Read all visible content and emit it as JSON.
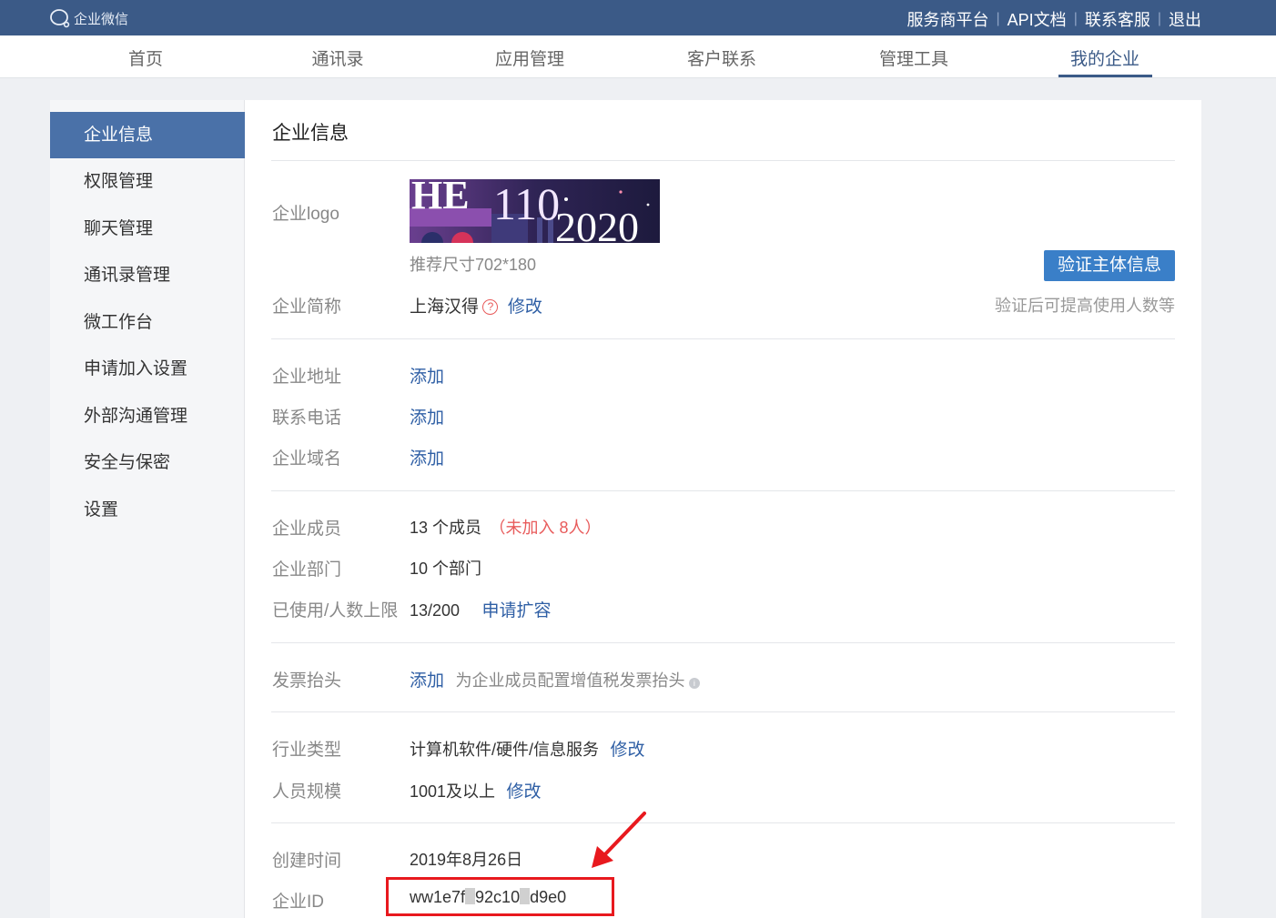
{
  "topbar": {
    "brand": "企业微信",
    "links": [
      "服务商平台",
      "API文档",
      "联系客服",
      "退出"
    ]
  },
  "nav": {
    "items": [
      "首页",
      "通讯录",
      "应用管理",
      "客户联系",
      "管理工具",
      "我的企业"
    ],
    "active": "我的企业"
  },
  "sidebar": {
    "items": [
      "企业信息",
      "权限管理",
      "聊天管理",
      "通讯录管理",
      "微工作台",
      "申请加入设置",
      "外部沟通管理",
      "安全与保密",
      "设置"
    ],
    "active": "企业信息"
  },
  "main": {
    "title": "企业信息",
    "logo": {
      "label": "企业logo",
      "image_text_1": "HE",
      "image_text_2": "110",
      "image_text_3": "2020",
      "hint": "推荐尺寸702*180"
    },
    "verify": {
      "button_label": "验证主体信息",
      "note": "验证后可提高使用人数等"
    },
    "short_name": {
      "label": "企业简称",
      "value": "上海汉得",
      "help_icon": "?",
      "edit": "修改"
    },
    "address": {
      "label": "企业地址",
      "action": "添加"
    },
    "phone": {
      "label": "联系电话",
      "action": "添加"
    },
    "domain": {
      "label": "企业域名",
      "action": "添加"
    },
    "members": {
      "label": "企业成员",
      "value": "13 个成员",
      "not_joined": "（未加入 8人）"
    },
    "departments": {
      "label": "企业部门",
      "value": "10 个部门"
    },
    "usage": {
      "label": "已使用/人数上限",
      "value": "13/200",
      "action": "申请扩容"
    },
    "invoice": {
      "label": "发票抬头",
      "action": "添加",
      "desc": "为企业成员配置增值税发票抬头",
      "info_icon": "i"
    },
    "industry": {
      "label": "行业类型",
      "value": "计算机软件/硬件/信息服务",
      "edit": "修改"
    },
    "scale": {
      "label": "人员规模",
      "value": "1001及以上",
      "edit": "修改"
    },
    "created": {
      "label": "创建时间",
      "value": "2019年8月26日"
    },
    "corp_id": {
      "label": "企业ID",
      "part1": "ww1e7f",
      "part2": "92c10",
      "part3": "d9e0"
    }
  },
  "colors": {
    "topbar_bg": "#3b5a87",
    "accent": "#3b5a87",
    "sidebar_active": "#4a71a8",
    "link": "#2f5fa5",
    "button": "#3a7fc8",
    "annotation": "#e8191e",
    "warning_text": "#e85b5b"
  }
}
